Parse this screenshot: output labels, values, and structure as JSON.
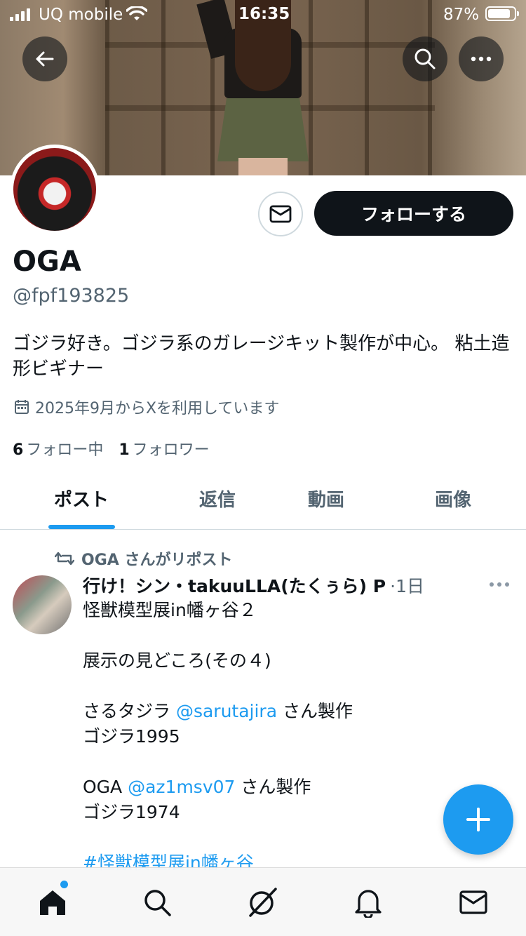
{
  "status_bar": {
    "carrier": "UQ mobile",
    "time": "16:35",
    "battery_percent": "87%",
    "battery_level": 0.87
  },
  "header": {
    "back_icon": "arrow-left-icon",
    "search_icon": "search-icon",
    "more_icon": "more-horizontal-icon"
  },
  "profile": {
    "name": "OGA",
    "handle": "@fpf193825",
    "bio": "ゴジラ好き。ゴジラ系のガレージキット製作が中心。 粘土造形ビギナー",
    "joined": "2025年9月からXを利用しています",
    "following_count": "6",
    "following_label": "フォロー中",
    "followers_count": "1",
    "followers_label": "フォロワー",
    "follow_button": "フォローする"
  },
  "tabs": [
    {
      "label": "ポスト",
      "active": true
    },
    {
      "label": "返信",
      "active": false
    },
    {
      "label": "動画",
      "active": false
    },
    {
      "label": "画像",
      "active": false
    }
  ],
  "post": {
    "repost_label": "OGA さんがリポスト",
    "author": "行け！シン・takuuLLA(たくぅら) P",
    "time": "·1日",
    "lines": {
      "l1": "怪獣模型展in幡ヶ谷２",
      "l2": "展示の見どころ(その４)",
      "l3_pre": "さるタジラ ",
      "l3_link": "@sarutajira",
      "l3_post": " さん製作",
      "l4": "ゴジラ1995",
      "l5_pre": "OGA ",
      "l5_link": "@az1msv07",
      "l5_post": " さん製作",
      "l6": "ゴジラ1974",
      "l7_link": "#怪獣模型展in幡ヶ谷"
    }
  },
  "fab": {
    "icon": "plus-icon"
  },
  "bottom_nav": [
    {
      "icon": "home-icon",
      "active": true,
      "badge": true
    },
    {
      "icon": "search-icon"
    },
    {
      "icon": "grok-icon"
    },
    {
      "icon": "bell-icon"
    },
    {
      "icon": "mail-icon"
    }
  ],
  "colors": {
    "accent": "#1d9bf0",
    "text_primary": "#0f1419",
    "text_secondary": "#536471",
    "follow_button_bg": "#0f1419"
  }
}
